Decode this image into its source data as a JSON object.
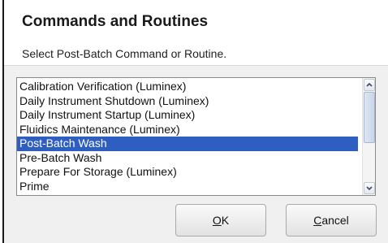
{
  "dialog": {
    "title": "Commands and Routines",
    "instruction": "Select Post-Batch Command or Routine."
  },
  "list": {
    "items": [
      "Calibration Verification (Luminex)",
      "Daily Instrument Shutdown (Luminex)",
      "Daily Instrument Startup (Luminex)",
      "Fluidics Maintenance (Luminex)",
      "Post-Batch Wash",
      "Pre-Batch Wash",
      "Prepare For Storage (Luminex)",
      "Prime"
    ],
    "selected": "Post-Batch Wash"
  },
  "buttons": {
    "ok": {
      "mnemonic": "O",
      "rest": "K"
    },
    "cancel": {
      "mnemonic": "C",
      "rest": "ancel"
    }
  },
  "colors": {
    "selection": "#2f5ec1",
    "selection_text": "#ffffff",
    "panel": "#f0f0f0"
  },
  "icons": {
    "scroll_up": "chevron-up-icon",
    "scroll_down": "chevron-down-icon"
  }
}
